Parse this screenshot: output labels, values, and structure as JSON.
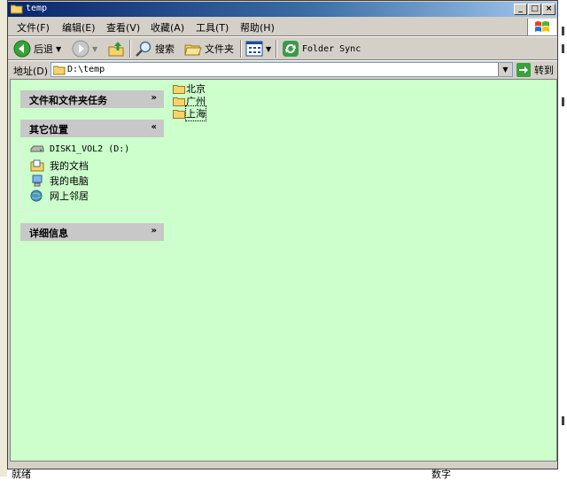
{
  "window": {
    "title": "temp"
  },
  "menu": [
    "文件(F)",
    "编辑(E)",
    "查看(V)",
    "收藏(A)",
    "工具(T)",
    "帮助(H)"
  ],
  "toolbar": {
    "back": "后退",
    "search": "搜索",
    "folders": "文件夹",
    "folder_sync": "Folder Sync"
  },
  "address": {
    "label": "地址(D)",
    "value": "D:\\temp",
    "go": "转到"
  },
  "tasks": {
    "file_tasks": {
      "title": "文件和文件夹任务"
    },
    "other_places": {
      "title": "其它位置",
      "items": [
        "DISK1_VOL2 (D:)",
        "我的文档",
        "我的电脑",
        "网上邻居"
      ]
    },
    "details": {
      "title": "详细信息"
    }
  },
  "folders": [
    "北京",
    "广州",
    "上海"
  ],
  "status": {
    "left": "就绪",
    "right": "数字"
  },
  "icons": {
    "title": "folder-icon",
    "back": "back-arrow-icon",
    "forward": "forward-arrow-icon",
    "up": "folder-up-icon",
    "search": "search-icon",
    "folders": "folders-icon",
    "views": "views-icon",
    "sync": "sync-icon",
    "go": "go-arrow-icon",
    "drive": "drive-icon",
    "documents": "my-documents-icon",
    "computer": "my-computer-icon",
    "network": "network-icon"
  },
  "colors": {
    "content_bg": "#ccffcc",
    "panel_header": "#c8c8c8",
    "titlebar_start": "#0a246a",
    "titlebar_end": "#a6caf0"
  }
}
